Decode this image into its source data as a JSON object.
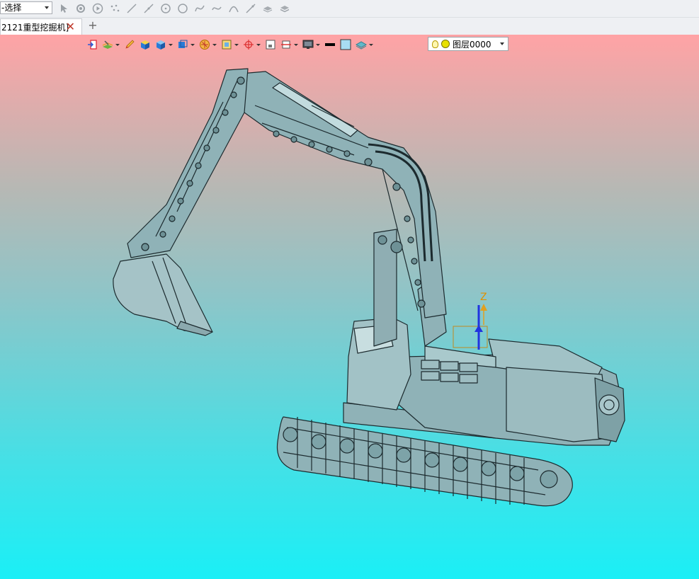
{
  "filter_select": {
    "value": "-选择"
  },
  "top_toolbar": {
    "icons": [
      "select-pointer-icon",
      "select-gear-icon",
      "play-circle-icon",
      "points-icon",
      "line-icon",
      "ray-icon",
      "circle-center-icon",
      "circle-icon",
      "spline-icon",
      "curve-icon",
      "arc-icon",
      "tangent-line-icon",
      "layer-cube-icon",
      "stack-icon"
    ]
  },
  "tabs": [
    {
      "label": "2121重型挖掘机]",
      "active": true
    }
  ],
  "view_toolbar": {
    "icons": [
      "exit-icon",
      "layer-brush-icon",
      "pencil-icon",
      "box-yellow-icon",
      "cube-blue-icon",
      "cube-camera-icon",
      "compass-icon",
      "frame-icon",
      "target-icon",
      "single-view-icon",
      "section-icon",
      "monitor-icon",
      "line-color-icon",
      "fill-color-icon",
      "layer-sheet-icon"
    ]
  },
  "layer_select": {
    "value": "图层0000"
  },
  "viewport": {
    "gradient": {
      "top": "#ffa3a5",
      "bottom": "#1aeff6"
    },
    "axis_label": "Z",
    "model_color": "#8fb2b7"
  }
}
